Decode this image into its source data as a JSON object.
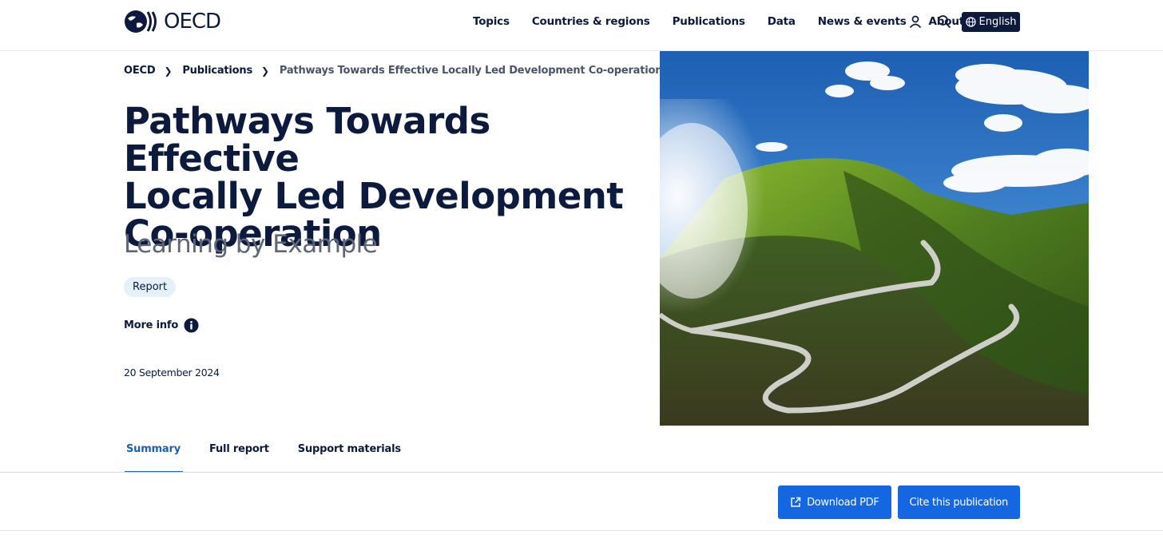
{
  "header": {
    "logo_text": "OECD",
    "nav": [
      "Topics",
      "Countries & regions",
      "Publications",
      "Data",
      "News & events",
      "About"
    ],
    "account_icon": "user-icon",
    "search_icon": "search-icon",
    "language_label": "English",
    "language_icon": "globe-icon"
  },
  "breadcrumb": {
    "items": [
      "OECD",
      "Publications"
    ],
    "current": "Pathways Towards Effective Locally Led Development Co-operation"
  },
  "publication": {
    "title_lines": [
      "Pathways Towards Effective",
      "Locally Led Development",
      "Co-operation"
    ],
    "subtitle": "Learning by Example",
    "type_badge": "Report",
    "more_info_label": "More info",
    "date": "20 September 2024"
  },
  "tabs": [
    {
      "label": "Summary",
      "active": true
    },
    {
      "label": "Full report",
      "active": false
    },
    {
      "label": "Support materials",
      "active": false
    }
  ],
  "actions": {
    "download_label": "Download PDF",
    "cite_label": "Cite this publication"
  },
  "colors": {
    "navy": "#0b1a3d",
    "accent_blue": "#1467e0",
    "active_tab": "#1b60b4",
    "badge_bg": "#e5f0f9"
  }
}
